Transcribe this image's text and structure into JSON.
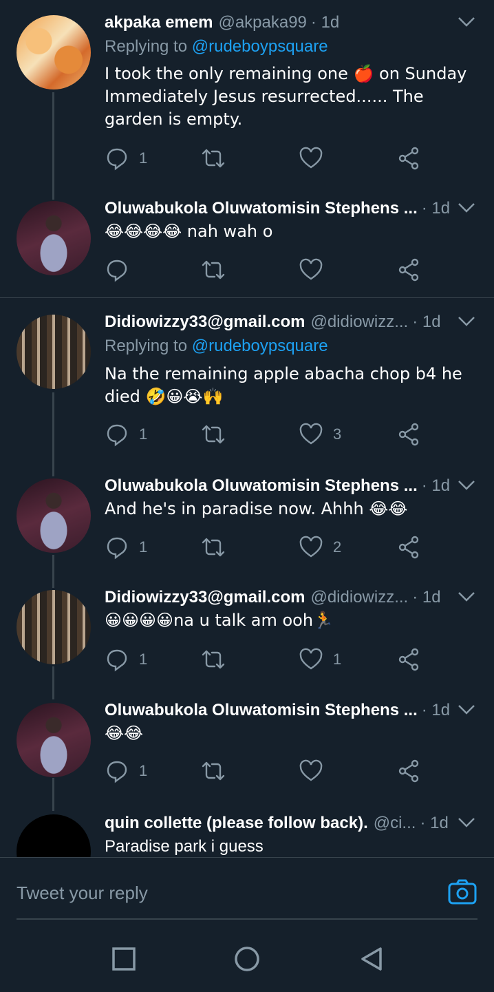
{
  "tweets": [
    {
      "name": "akpaka emem",
      "handle": "@akpaka99",
      "time": "· 1d",
      "replying_prefix": "Replying to ",
      "replying_to": "@rudeboypsquare",
      "text": "I took the only remaining one 🍎 on Sunday Immediately Jesus resurrected...... The garden is empty.",
      "replies": "1",
      "retweets": "",
      "likes": ""
    },
    {
      "name": "Oluwabukola Oluwatomisin Stephens ...",
      "handle": "",
      "time": "· 1d",
      "text": "😂😂😂😂 nah wah o",
      "replies": "",
      "retweets": "",
      "likes": ""
    },
    {
      "name": "Didiowizzy33@gmail.com",
      "handle": "@didiowizz...",
      "time": "· 1d",
      "replying_prefix": "Replying to ",
      "replying_to": "@rudeboypsquare",
      "text": "Na the remaining apple abacha chop b4 he died 🤣😀😭🙌",
      "replies": "1",
      "retweets": "",
      "likes": "3"
    },
    {
      "name": "Oluwabukola Oluwatomisin Stephens ...",
      "handle": "",
      "time": "· 1d",
      "text": "And he's in paradise now. Ahhh 😂😂",
      "replies": "1",
      "retweets": "",
      "likes": "2"
    },
    {
      "name": "Didiowizzy33@gmail.com",
      "handle": "@didiowizz...",
      "time": "· 1d",
      "text": "😀😀😀😀na u talk am ooh🏃",
      "replies": "1",
      "retweets": "",
      "likes": "1"
    },
    {
      "name": "Oluwabukola Oluwatomisin Stephens ...",
      "handle": "",
      "time": "· 1d",
      "text": "😂😂",
      "replies": "1",
      "retweets": "",
      "likes": ""
    },
    {
      "name": "quin collette (please follow back).",
      "handle": "@ci...",
      "time": "· 1d",
      "text": "Paradise park i guess"
    }
  ],
  "reply_bar": {
    "placeholder": "Tweet your reply"
  },
  "icons": {
    "reply": "reply-icon",
    "retweet": "retweet-icon",
    "like": "heart-icon",
    "share": "share-icon",
    "menu": "chevron-down-icon",
    "camera": "camera-icon"
  },
  "colors": {
    "background": "#15202b",
    "accent": "#1da1f2",
    "secondary_text": "#8899a6",
    "divider": "#38444d"
  }
}
